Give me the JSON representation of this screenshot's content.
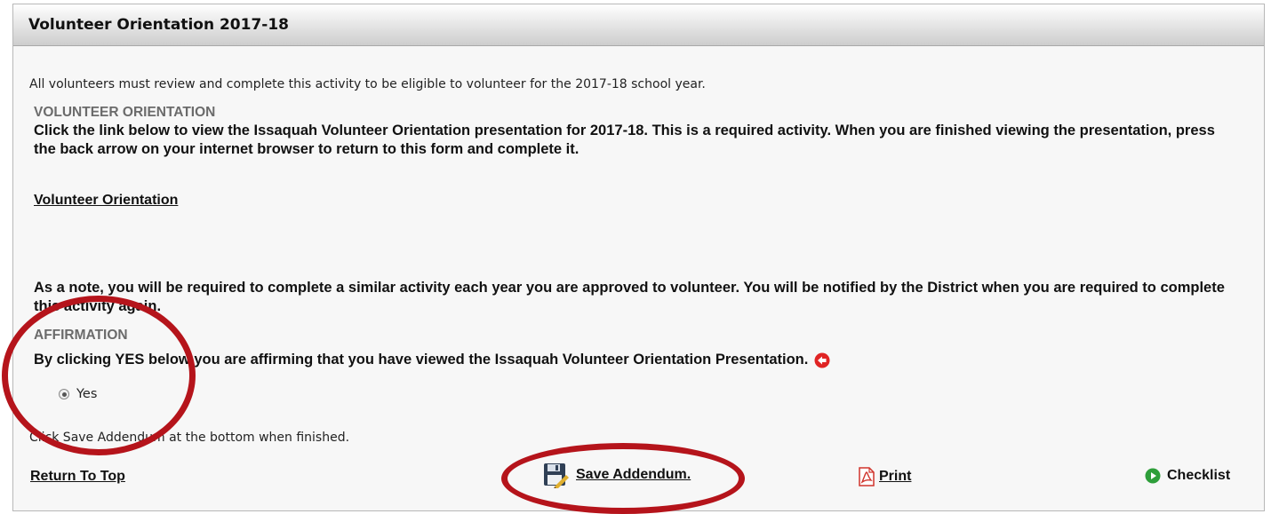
{
  "panel": {
    "title": "Volunteer Orientation 2017-18",
    "intro": "All volunteers must review and complete this activity to be eligible to volunteer for the 2017-18 school year.",
    "orientation_heading": "VOLUNTEER ORIENTATION",
    "orientation_text": "Click the link below to view the Issaquah Volunteer Orientation presentation for 2017-18. This is a required activity. When you are finished viewing the presentation, press the back arrow on your internet browser to return to this form and complete it.",
    "orientation_link": "Volunteer Orientation",
    "note_text": "As a note, you will be required to complete a similar activity each year you are approved to volunteer. You will be notified by the District when you are required to complete this activity again.",
    "affirmation_heading": "AFFIRMATION",
    "affirmation_text": "By clicking YES below you are affirming that you have viewed the Issaquah Volunteer Orientation Presentation.",
    "affirmation_required_icon": "red-circle-arrow-icon",
    "yes_label": "Yes",
    "yes_selected": true,
    "save_instruction": "Click Save Addendum at the bottom when finished."
  },
  "footer": {
    "return_to_top": "Return To Top",
    "save_addendum": "Save Addendum.",
    "save_icon": "floppy-disk-pencil-icon",
    "print": "Print",
    "print_icon": "pdf-icon",
    "checklist": "Checklist",
    "checklist_icon": "green-play-circle-icon"
  },
  "colors": {
    "highlight_ring": "#b5141b",
    "required_icon": "#e02424",
    "checklist_icon": "#2e9e3a",
    "pdf_icon": "#d0342c"
  }
}
